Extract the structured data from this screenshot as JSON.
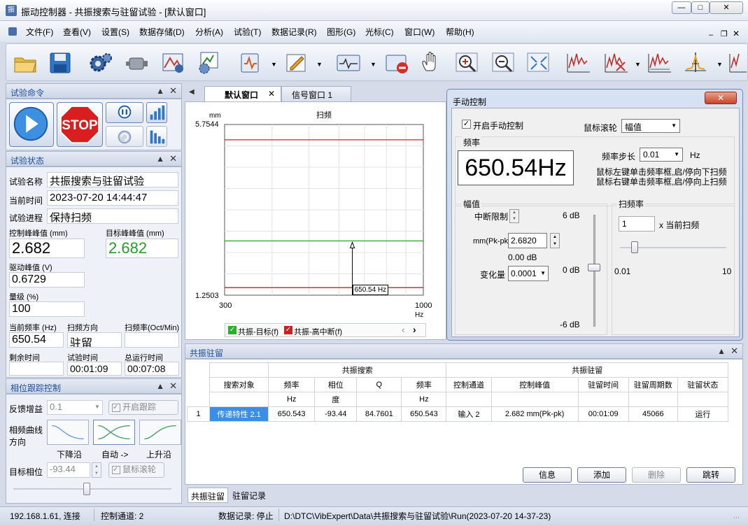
{
  "window": {
    "title": "振动控制器 - 共振搜索与驻留试验 - [默认窗口]",
    "app_icon": "振"
  },
  "menu": [
    "文件(F)",
    "查看(V)",
    "设置(S)",
    "数据存储(D)",
    "分析(A)",
    "试验(T)",
    "数据记录(R)",
    "图形(G)",
    "光标(C)",
    "窗口(W)",
    "帮助(H)"
  ],
  "test_cmd": {
    "title": "试验命令",
    "stop_label": "STOP"
  },
  "test_status": {
    "title": "试验状态",
    "name_label": "试验名称",
    "name": "共振搜索与驻留试验",
    "time_label": "当前时间",
    "time": "2023-07-20 14:44:47",
    "progress_label": "试验进程",
    "progress": "保持扫频",
    "ctrl_peak_label": "控制峰峰值 (mm)",
    "ctrl_peak": "2.682",
    "target_peak_label": "目标峰峰值 (mm)",
    "target_peak": "2.682",
    "drive_label": "驱动峰值 (V)",
    "drive": "0.6729",
    "level_label": "量级 (%)",
    "level": "100",
    "freq_label": "当前频率 (Hz)",
    "freq": "650.54",
    "dir_label": "扫频方向",
    "dir": "驻留",
    "rate_label": "扫频率(Oct/Min)",
    "rate": "",
    "remain_label": "剩余时间",
    "remain": "",
    "test_time_label": "试验时间",
    "test_time": "00:01:09",
    "total_label": "总运行时间",
    "total": "00:07:08"
  },
  "phase": {
    "title": "相位跟踪控制",
    "gain_label": "反馈增益",
    "gain": "0.1",
    "track_label": "开启跟踪",
    "curve_label": "相频曲线方向",
    "down": "下降沿",
    "auto": "自动 ->",
    "up": "上升沿",
    "target_label": "目标相位",
    "target": "-93.44",
    "wheel_label": "鼠标滚轮"
  },
  "tabs": [
    "默认窗口",
    "信号窗口 1"
  ],
  "chart_data": {
    "type": "line",
    "title": "扫频",
    "ylabel": "mm",
    "xlabel": "Hz",
    "ylim": [
      1.2503,
      5.7544
    ],
    "xlim": [
      300,
      1000
    ],
    "x_ticks": [
      "300",
      "1000"
    ],
    "y_ticks": [
      "5.7544",
      "1.2503"
    ],
    "series": [
      {
        "name": "共振-目标(f)",
        "color": "#2ab12a",
        "y": 2.682
      },
      {
        "name": "共振-高中断(f)",
        "color": "#cc2222",
        "y_upper": 5.35,
        "y_lower": 1.45
      }
    ],
    "cursor": {
      "x": 650.54,
      "label": "650.54 Hz"
    }
  },
  "manual": {
    "title": "手动控制",
    "enable_label": "开启手动控制",
    "wheel_label": "鼠标滚轮",
    "wheel_value": "幅值",
    "freq_group": "频率",
    "freq_display": "650.54Hz",
    "step_label": "频率步长",
    "step": "0.01",
    "step_unit": "Hz",
    "hint1": "鼠标左键单击频率框,启/停向下扫频",
    "hint2": "鼠标右键单击频率框,启/停向上扫频",
    "amp_group": "幅值",
    "abort_label": "中断限制",
    "unit_label": "mm(Pk-pk)",
    "amp_value": "2.6820",
    "db_value": "0.00 dB",
    "change_label": "变化量",
    "change": "0.0001",
    "slider_top": "6 dB",
    "slider_mid": "0 dB",
    "slider_bot": "-6 dB",
    "rate_group": "扫频率",
    "rate": "1",
    "rate_unit": "x 当前扫频",
    "rate_min": "0.01",
    "rate_max": "10"
  },
  "reso": {
    "title": "共振驻留",
    "group_search": "共振搜索",
    "group_dwell": "共振驻留",
    "headers": [
      "搜索对象",
      "频率",
      "相位",
      "Q",
      "频率",
      "控制通道",
      "控制峰值",
      "驻留时间",
      "驻留周期数",
      "驻留状态"
    ],
    "units": [
      "",
      "Hz",
      "度",
      "",
      "Hz",
      "",
      "",
      "",
      "",
      ""
    ],
    "row": [
      "1",
      "传递特性 2.1",
      "650.543",
      "-93.44",
      "84.7601",
      "650.543",
      "输入 2",
      "2.682 mm(Pk-pk)",
      "00:01:09",
      "45066",
      "运行"
    ],
    "buttons": [
      "信息",
      "添加",
      "删除",
      "跳转"
    ],
    "bottom_tabs": [
      "共振驻留",
      "驻留记录"
    ]
  },
  "status": {
    "conn": "192.168.1.61, 连接",
    "channel": "控制通道: 2",
    "record": "数据记录: 停止",
    "path": "D:\\DTC\\VibExpert\\Data\\共振搜索与驻留试验\\Run(2023-07-20 14-37-23)"
  }
}
